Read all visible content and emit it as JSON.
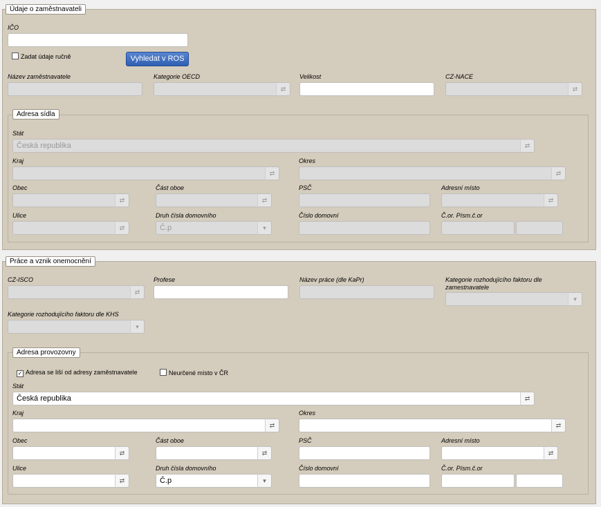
{
  "employer": {
    "legend": "Údaje o zaměstnavateli",
    "ico_label": "IČO",
    "ico_value": "",
    "manual_checkbox": {
      "label": "Zadat údaje ručně",
      "checked": false
    },
    "search_button": "Vyhledat v ROS",
    "name_label": "Název zaměstnavatele",
    "oecd_label": "Kategorie OECD",
    "size_label": "Velikost",
    "nace_label": "CZ-NACE"
  },
  "hq": {
    "legend": "Adresa sídla",
    "state_label": "Stát",
    "state_value": "Česká republika",
    "region_label": "Kraj",
    "district_label": "Okres",
    "municipality_label": "Obec",
    "part_label": "Část oboe",
    "psc_label": "PSČ",
    "addr_place_label": "Adresní místo",
    "street_label": "Ulice",
    "house_type_label": "Druh čísla domovního",
    "house_type_value": "Č.p",
    "house_no_label": "Číslo domovní",
    "orient_label": "Č.or. Písm.č.or"
  },
  "work": {
    "legend": "Práce a vznik onemocnění",
    "isco_label": "CZ-ISCO",
    "profession_label": "Profese",
    "work_name_label": "Název práce (dle KaPr)",
    "risk_employer_label": "Kategorie rozhodujícího faktoru dle zamestnavatele",
    "risk_khs_label": "Kategorie rozhodujícího faktoru dle KHS"
  },
  "site": {
    "legend": "Adresa provozovny",
    "differs_checkbox": {
      "label": "Adresa se liší od adresy zaměstnavatele",
      "checked": true
    },
    "undetermined_checkbox": {
      "label": "Neurčené místo v ČR",
      "checked": false
    },
    "state_label": "Stát",
    "state_value": "Česká republika",
    "region_label": "Kraj",
    "district_label": "Okres",
    "municipality_label": "Obec",
    "part_label": "Část oboe",
    "psc_label": "PSČ",
    "addr_place_label": "Adresní místo",
    "street_label": "Ulice",
    "house_type_label": "Druh čísla domovního",
    "house_type_value": "Č.p",
    "house_no_label": "Číslo domovní",
    "orient_label": "Č.or. Písm.č.or"
  },
  "icons": {
    "lookup": "link-icon",
    "dropdown": "caret-down-icon"
  },
  "colors": {
    "panel": "#d4ccbc",
    "button": "#2f5fb2"
  }
}
